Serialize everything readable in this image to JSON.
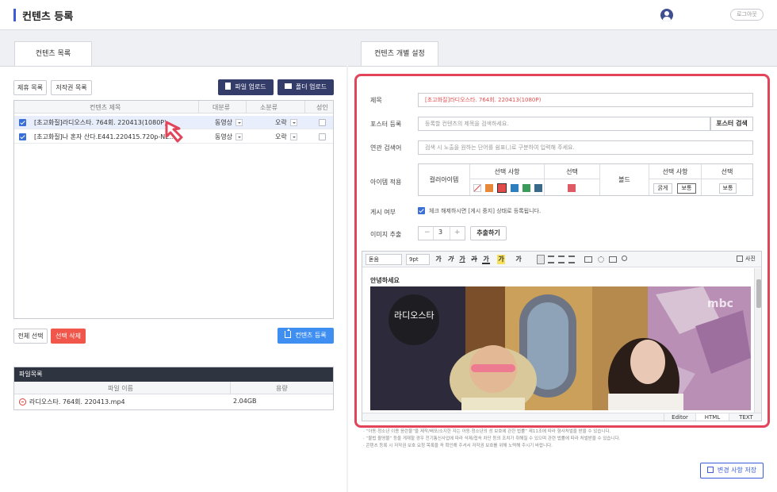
{
  "header": {
    "title": "컨텐츠 등록",
    "logout": "로그아웃"
  },
  "left": {
    "tab": "컨텐츠 목록",
    "buttons": {
      "partner_list": "제휴 목록",
      "copyright_list": "저작권 목록",
      "file_upload": "파일 업로드",
      "folder_upload": "폴더 업로드",
      "select_all": "전체 선택",
      "delete_selected": "선택 삭제",
      "register": "컨텐츠 등록"
    },
    "columns": [
      "컨텐츠 제목",
      "대분류",
      "소분류",
      "성인"
    ],
    "rows": [
      {
        "title": "[초고화질]라디오스타. 764회. 220413(1080P)",
        "major": "동영상",
        "minor": "오락"
      },
      {
        "title": "[초고화질]나 혼자 산다.E441.220415.720p-NE...",
        "major": "동영상",
        "minor": "오락"
      }
    ],
    "files": {
      "title": "파일목록",
      "columns": [
        "파일 이름",
        "용량"
      ],
      "rows": [
        {
          "name": "라디오스타. 764회. 220413.mp4",
          "size": "2.04GB"
        }
      ]
    }
  },
  "right": {
    "tab": "컨텐츠 개별 설정",
    "form": {
      "title_label": "제목",
      "title_value": "[초고화질]라디오스타. 764회. 220413(1080P)",
      "poster_label": "포스터 등록",
      "poster_placeholder": "등록할 컨텐츠의 제목을 검색하세요.",
      "poster_search": "포스터 검색",
      "keyword_label": "연관 검색어",
      "keyword_placeholder": "검색 시 노출을 원하는 단어를 쉼표(,)로 구분하여 입력해 주세요.",
      "item_label": "아이템 적용",
      "item_table": {
        "color_item": "컬러아이템",
        "select_items": "선택 사항",
        "select": "선택",
        "bold": "볼드",
        "bold_select_items": "선택 사항",
        "bold_select": "선택",
        "public": "굵게",
        "normal": "보통",
        "normal2": "보통"
      },
      "swatch_colors": [
        "#e8883a",
        "#e34b4b",
        "#2f7fbf",
        "#3a9b5b",
        "#3a6a8a"
      ],
      "selected_color": "#e05a66",
      "post_label": "게시 여부",
      "post_text": "체크 해제하시면 [게시 중지] 상태로 등록됩니다.",
      "extract_label": "이미지 추출",
      "extract_minus": "−",
      "extract_count": "3",
      "extract_plus": "+",
      "extract_button": "추출하기"
    },
    "editor": {
      "font": "돋움",
      "size": "9pt",
      "photo": "사진",
      "content": "안녕하세요",
      "tabs": [
        "Editor",
        "HTML",
        "TEXT"
      ],
      "tools": [
        "가",
        "가",
        "가",
        "가",
        "가",
        "가",
        "가"
      ],
      "overlay_logo": "mbc",
      "overlay_title": "라디오스타"
    },
    "notes": [
      "· “아동·청소년 이용 음란물”을 제작/배포/소지한 자는 아동·청소년의 성 보호에 관한 법률” 제11조에 따라 형사처벌을 받을 수 있습니다.",
      "· “불법 촬영물” 등을 게재할 경우 전기통신사업에 따라 삭제/접속 차단 등의 조치가 취해질 수 있으며 관련 법률에 따라 처벌받을 수 있습니다.",
      "· 콘텐츠 등록 시 저작권 보호 요청 목록을 꼭 확인해 주셔서 저작권 보호를 위해 노력해 주시기 바랍니다."
    ],
    "save_button": "변경 사항 저장"
  }
}
